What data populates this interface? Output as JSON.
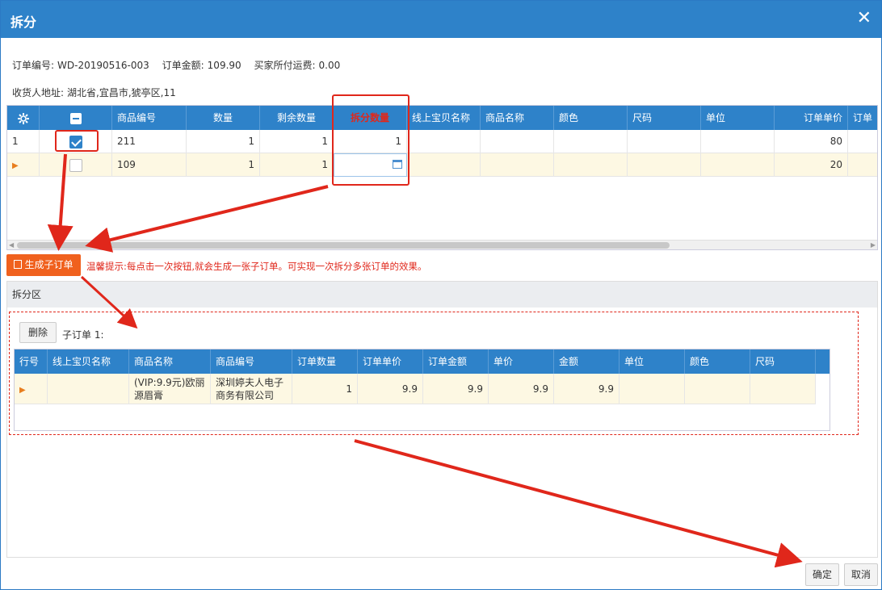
{
  "dialog": {
    "title": "拆分",
    "close_icon": "close-icon"
  },
  "order_info": {
    "order_no_label": "订单编号:",
    "order_no": "WD-20190516-003",
    "amount_label": "订单金额:",
    "amount": "109.90",
    "freight_label": "买家所付运费:",
    "freight": "0.00",
    "address_label": "收货人地址:",
    "address": "湖北省,宜昌市,猇亭区,11"
  },
  "top_grid": {
    "columns": [
      "商品编号",
      "数量",
      "剩余数量",
      "拆分数量",
      "线上宝贝名称",
      "商品名称",
      "颜色",
      "尺码",
      "单位",
      "订单单价",
      "订单"
    ],
    "rows": [
      {
        "row_no": "1",
        "checked": true,
        "code": "211",
        "qty": "1",
        "remain": "1",
        "split_qty": "1",
        "price": "80"
      },
      {
        "row_no": "",
        "checked": false,
        "code": "109",
        "qty": "1",
        "remain": "1",
        "split_qty": "",
        "price": "20"
      }
    ]
  },
  "generate_button": "生成子订单",
  "tip_text": "温馨提示:每点击一次按钮,就会生成一张子订单。可实现一次拆分多张订单的效果。",
  "split_area": {
    "header": "拆分区",
    "delete_button": "删除",
    "sub_order_title": "子订单 1:",
    "columns": [
      "行号",
      "线上宝贝名称",
      "商品名称",
      "商品编号",
      "订单数量",
      "订单单价",
      "订单金额",
      "单价",
      "金额",
      "单位",
      "颜色",
      "尺码"
    ],
    "rows": [
      {
        "online_name": "",
        "product_name": "(VIP:9.9元)欧丽源眉膏",
        "code": "深圳婷夫人电子商务有限公司",
        "qty": "1",
        "unit_price": "9.9",
        "order_amount": "9.9",
        "price": "9.9",
        "amount": "9.9"
      }
    ]
  },
  "footer": {
    "ok": "确定",
    "cancel": "取消"
  },
  "colors": {
    "header_blue": "#2e82c9",
    "accent_orange": "#f0611e",
    "annotation_red": "#e0271b",
    "selected_row": "#fdf8e3"
  }
}
